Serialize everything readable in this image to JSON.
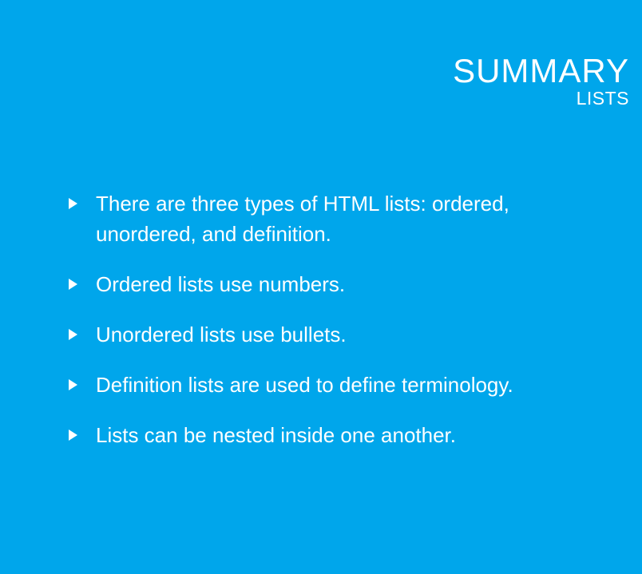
{
  "header": {
    "title": "SUMMARY",
    "subtitle": "LISTS"
  },
  "bullets": [
    {
      "text": "There are three types of HTML lists: ordered, unordered, and definition.",
      "icon": "triangle-right-icon"
    },
    {
      "text": "Ordered lists use numbers.",
      "icon": "triangle-right-icon"
    },
    {
      "text": "Unordered lists use bullets.",
      "icon": "triangle-right-icon"
    },
    {
      "text": "Definition lists are used to define terminology.",
      "icon": "triangle-right-icon"
    },
    {
      "text": "Lists can be nested inside one another.",
      "icon": "triangle-right-icon"
    }
  ],
  "colors": {
    "background": "#00a6eb",
    "text": "#ffffff"
  }
}
